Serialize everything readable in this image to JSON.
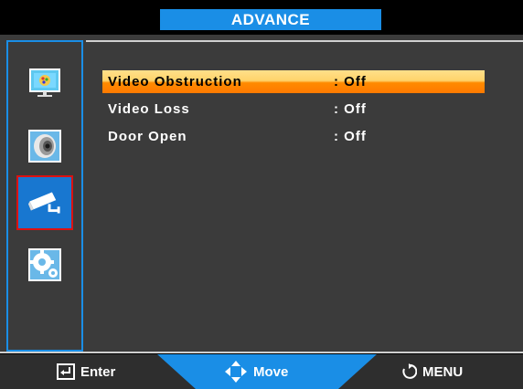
{
  "header": {
    "title": "ADVANCE"
  },
  "sidebar": {
    "items": [
      {
        "name": "picture",
        "icon": "picture-icon",
        "active": false
      },
      {
        "name": "audio",
        "icon": "speaker-icon",
        "active": false
      },
      {
        "name": "camera",
        "icon": "security-camera-icon",
        "active": true
      },
      {
        "name": "settings",
        "icon": "gear-icon",
        "active": false
      }
    ]
  },
  "menu": {
    "items": [
      {
        "label": "Video Obstruction",
        "value": ": Off",
        "selected": true
      },
      {
        "label": "Video Loss",
        "value": ": Off",
        "selected": false
      },
      {
        "label": "Door Open",
        "value": ": Off",
        "selected": false
      }
    ]
  },
  "footer": {
    "enter_label": "Enter",
    "move_label": "Move",
    "menu_label": "MENU"
  },
  "colors": {
    "accent": "#1a8ee6",
    "selected_top": "#ffd36a",
    "selected_bottom": "#ff7a00",
    "panel": "#3b3b3b"
  }
}
